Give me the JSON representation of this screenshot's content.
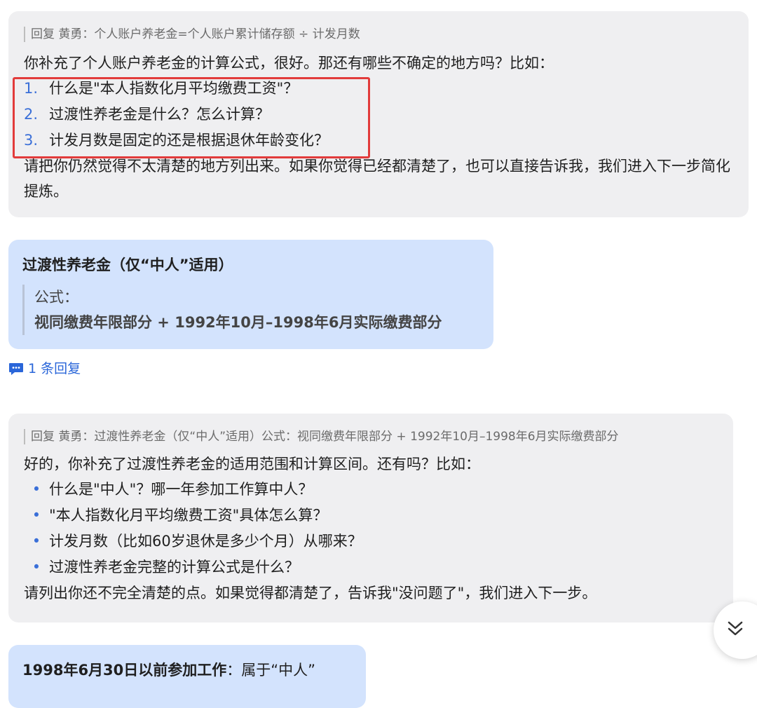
{
  "message1": {
    "quote": "回复 黄勇：个人账户养老金=个人账户累计储存额 ÷ 计发月数",
    "intro": "你补充了个人账户养老金的计算公式，很好。那还有哪些不确定的地方吗？比如：",
    "items": [
      {
        "num": "1.",
        "text": "什么是\"本人指数化月平均缴费工资\"？"
      },
      {
        "num": "2.",
        "text": "过渡性养老金是什么？怎么计算？"
      },
      {
        "num": "3.",
        "text": "计发月数是固定的还是根据退休年龄变化？"
      }
    ],
    "outro": "请把你仍然觉得不太清楚的地方列出来。如果你觉得已经都清楚了，也可以直接告诉我，我们进入下一步简化提炼。"
  },
  "message2": {
    "title": "过渡性养老金（仅“中人”适用）",
    "formula_label": "公式：",
    "formula": "视同缴费年限部分 + 1992年10月–1998年6月实际缴费部分"
  },
  "reply_link": {
    "label": "1 条回复",
    "icon": "comment-icon",
    "color": "#2a66d9"
  },
  "message3": {
    "quote": "回复 黄勇：过渡性养老金（仅“中人”适用）公式：视同缴费年限部分 + 1992年10月–1998年6月实际缴费部分",
    "intro": "好的，你补充了过渡性养老金的适用范围和计算区间。还有吗？比如：",
    "bullet": "•",
    "items": [
      "什么是\"中人\"？哪一年参加工作算中人？",
      "\"本人指数化月平均缴费工资\"具体怎么算？",
      "计发月数（比如60岁退休是多少个月）从哪来？",
      "过渡性养老金完整的计算公式是什么？"
    ],
    "outro": "请列出你还不完全清楚的点。如果觉得都清楚了，告诉我\"没问题了\"，我们进入下一步。"
  },
  "message4": {
    "bold": "1998年6月30日以前参加工作",
    "rest": "：属于“中人”"
  },
  "scroll_button": {
    "icon": "double-chevron-down-icon"
  },
  "colors": {
    "highlight_box": "#e23b3b",
    "user_bubble": "#d3e3fd",
    "ai_bubble": "#efeff1",
    "accent": "#3a6fd8"
  }
}
